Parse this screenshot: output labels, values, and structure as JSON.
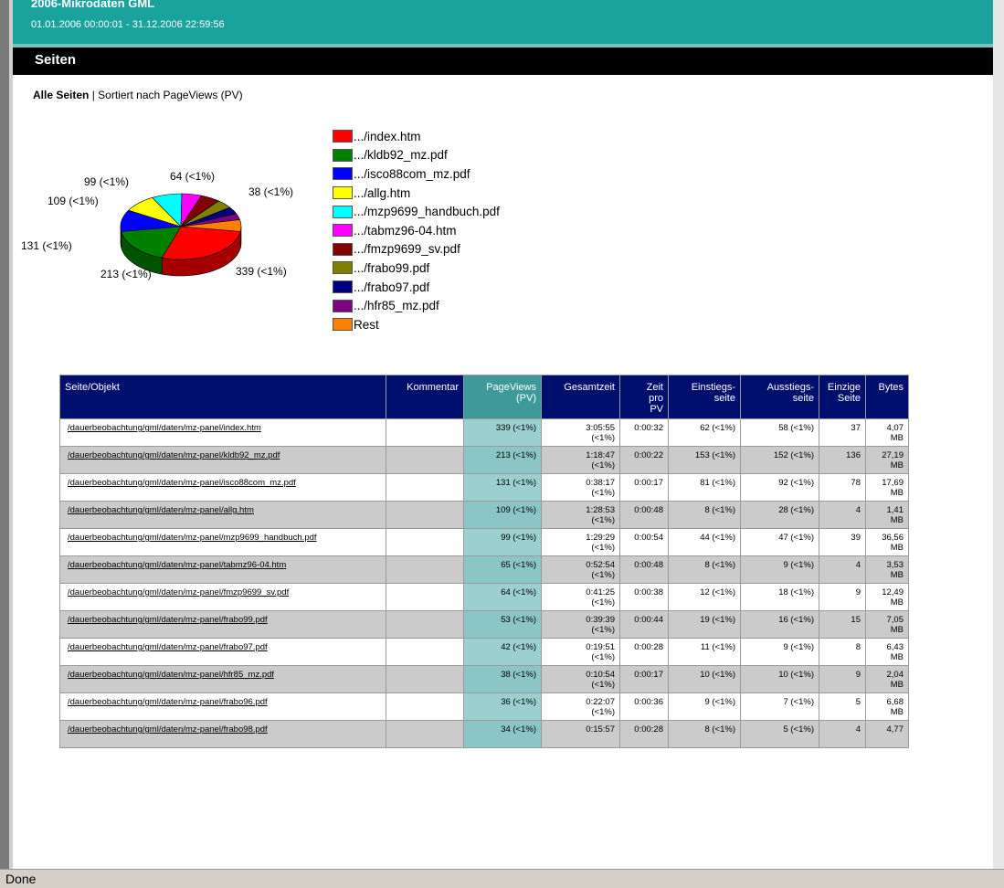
{
  "header": {
    "title": "2006-Mikrodaten GML",
    "daterange": "01.01.2006 00:00:01 - 31.12.2006 22:59:56",
    "section": "Seiten"
  },
  "subtitle": {
    "bold": "Alle Seiten",
    "rest": " | Sortiert nach PageViews (PV)"
  },
  "pie_labels": [
    "99 (<1%)",
    "64 (<1%)",
    "38 (<1%)",
    "109 (<1%)",
    "131 (<1%)",
    "213 (<1%)",
    "339 (<1%)"
  ],
  "legend": [
    {
      "label": ".../index.htm",
      "color": "#ff0000"
    },
    {
      "label": ".../kldb92_mz.pdf",
      "color": "#008000"
    },
    {
      "label": ".../isco88com_mz.pdf",
      "color": "#0000ff"
    },
    {
      "label": ".../allg.htm",
      "color": "#ffff00"
    },
    {
      "label": ".../mzp9699_handbuch.pdf",
      "color": "#00ffff"
    },
    {
      "label": ".../tabmz96-04.htm",
      "color": "#ff00ff"
    },
    {
      "label": ".../fmzp9699_sv.pdf",
      "color": "#800000"
    },
    {
      "label": ".../frabo99.pdf",
      "color": "#808000"
    },
    {
      "label": ".../frabo97.pdf",
      "color": "#000080"
    },
    {
      "label": ".../hfr85_mz.pdf",
      "color": "#800080"
    },
    {
      "label": "Rest",
      "color": "#ff8000"
    }
  ],
  "table": {
    "headers": {
      "seite": "Seite/Objekt",
      "kommentar": "Kommentar",
      "pv1": "PageViews",
      "pv2": "(PV)",
      "gesamtzeit": "Gesamtzeit",
      "zeit1": "Zeit",
      "zeit2": "pro",
      "zeit3": "PV",
      "einstieg1": "Einstiegs-",
      "einstieg2": "seite",
      "ausstieg1": "Ausstiegs-",
      "ausstieg2": "seite",
      "einzige1": "Einzige",
      "einzige2": "Seite",
      "bytes": "Bytes"
    },
    "rows": [
      {
        "seite": "/dauerbeobachtung/gml/daten/mz-panel/index.htm",
        "pv": "339 (<1%)",
        "gz1": "3:05:55",
        "gz2": "(<1%)",
        "zpp": "0:00:32",
        "ein": "62 (<1%)",
        "aus": "58 (<1%)",
        "einz": "37",
        "b1": "4,07",
        "b2": "MB"
      },
      {
        "seite": "/dauerbeobachtung/gml/daten/mz-panel/kldb92_mz.pdf",
        "pv": "213 (<1%)",
        "gz1": "1:18:47",
        "gz2": "(<1%)",
        "zpp": "0:00:22",
        "ein": "153 (<1%)",
        "aus": "152 (<1%)",
        "einz": "136",
        "b1": "27,19",
        "b2": "MB"
      },
      {
        "seite": "/dauerbeobachtung/gml/daten/mz-panel/isco88com_mz.pdf",
        "pv": "131 (<1%)",
        "gz1": "0:38:17",
        "gz2": "(<1%)",
        "zpp": "0:00:17",
        "ein": "81 (<1%)",
        "aus": "92 (<1%)",
        "einz": "78",
        "b1": "17,69",
        "b2": "MB"
      },
      {
        "seite": "/dauerbeobachtung/gml/daten/mz-panel/allg.htm",
        "pv": "109 (<1%)",
        "gz1": "1:28:53",
        "gz2": "(<1%)",
        "zpp": "0:00:48",
        "ein": "8 (<1%)",
        "aus": "28 (<1%)",
        "einz": "4",
        "b1": "1,41",
        "b2": "MB"
      },
      {
        "seite": "/dauerbeobachtung/gml/daten/mz-panel/mzp9699_handbuch.pdf",
        "pv": "99 (<1%)",
        "gz1": "1:29:29",
        "gz2": "(<1%)",
        "zpp": "0:00:54",
        "ein": "44 (<1%)",
        "aus": "47 (<1%)",
        "einz": "39",
        "b1": "36,56",
        "b2": "MB"
      },
      {
        "seite": "/dauerbeobachtung/gml/daten/mz-panel/tabmz96-04.htm",
        "pv": "65 (<1%)",
        "gz1": "0:52:54",
        "gz2": "(<1%)",
        "zpp": "0:00:48",
        "ein": "8 (<1%)",
        "aus": "9 (<1%)",
        "einz": "4",
        "b1": "3,53",
        "b2": "MB"
      },
      {
        "seite": "/dauerbeobachtung/gml/daten/mz-panel/fmzp9699_sv.pdf",
        "pv": "64 (<1%)",
        "gz1": "0:41:25",
        "gz2": "(<1%)",
        "zpp": "0:00:38",
        "ein": "12 (<1%)",
        "aus": "18 (<1%)",
        "einz": "9",
        "b1": "12,49",
        "b2": "MB"
      },
      {
        "seite": "/dauerbeobachtung/gml/daten/mz-panel/frabo99.pdf",
        "pv": "53 (<1%)",
        "gz1": "0:39:39",
        "gz2": "(<1%)",
        "zpp": "0:00:44",
        "ein": "19 (<1%)",
        "aus": "16 (<1%)",
        "einz": "15",
        "b1": "7,05",
        "b2": "MB"
      },
      {
        "seite": "/dauerbeobachtung/gml/daten/mz-panel/frabo97.pdf",
        "pv": "42 (<1%)",
        "gz1": "0:19:51",
        "gz2": "(<1%)",
        "zpp": "0:00:28",
        "ein": "11 (<1%)",
        "aus": "9 (<1%)",
        "einz": "8",
        "b1": "6,43",
        "b2": "MB"
      },
      {
        "seite": "/dauerbeobachtung/gml/daten/mz-panel/hfr85_mz.pdf",
        "pv": "38 (<1%)",
        "gz1": "0:10:54",
        "gz2": "(<1%)",
        "zpp": "0:00:17",
        "ein": "10 (<1%)",
        "aus": "10 (<1%)",
        "einz": "9",
        "b1": "2,04",
        "b2": "MB"
      },
      {
        "seite": "/dauerbeobachtung/gml/daten/mz-panel/frabo96.pdf",
        "pv": "36 (<1%)",
        "gz1": "0:22:07",
        "gz2": "(<1%)",
        "zpp": "0:00:36",
        "ein": "9 (<1%)",
        "aus": "7 (<1%)",
        "einz": "5",
        "b1": "6,68",
        "b2": "MB"
      },
      {
        "seite": "/dauerbeobachtung/gml/daten/mz-panel/frabo98.pdf",
        "pv": "34 (<1%)",
        "gz1": "0:15:57",
        "gz2": "",
        "zpp": "0:00:28",
        "ein": "8 (<1%)",
        "aus": "5 (<1%)",
        "einz": "4",
        "b1": "4,77",
        "b2": ""
      }
    ]
  },
  "status": "Done"
}
